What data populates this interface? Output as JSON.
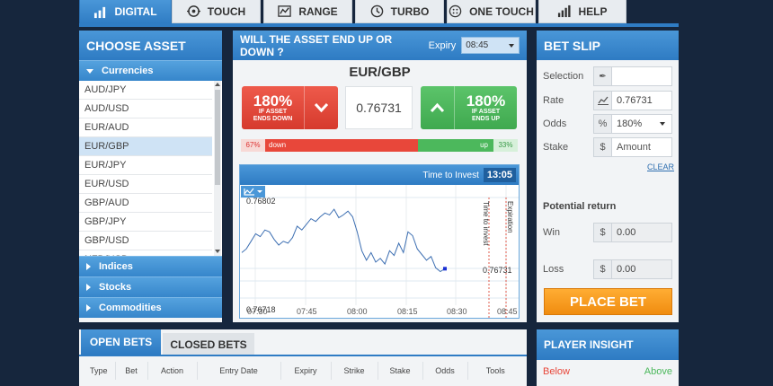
{
  "tabs": [
    {
      "label": "DIGITAL",
      "icon": "bar-chart-icon",
      "active": true
    },
    {
      "label": "TOUCH",
      "icon": "target-icon",
      "active": false
    },
    {
      "label": "RANGE",
      "icon": "range-chart-icon",
      "active": false
    },
    {
      "label": "TURBO",
      "icon": "clock-icon",
      "active": false
    },
    {
      "label": "ONE TOUCH",
      "icon": "dice-icon",
      "active": false
    },
    {
      "label": "HELP",
      "icon": "help-chart-icon",
      "active": false
    }
  ],
  "choose_asset": {
    "title": "CHOOSE ASSET",
    "open_category": "Currencies",
    "assets": [
      "AUD/JPY",
      "AUD/USD",
      "EUR/AUD",
      "EUR/GBP",
      "EUR/JPY",
      "EUR/USD",
      "GBP/AUD",
      "GBP/JPY",
      "GBP/USD",
      "NZD/USD"
    ],
    "selected": "EUR/GBP",
    "other_categories": [
      "Indices",
      "Stocks",
      "Commodities"
    ]
  },
  "question": {
    "title": "WILL THE ASSET END UP OR DOWN ?",
    "expiry_label": "Expiry",
    "expiry_value": "08:45"
  },
  "asset": {
    "name": "EUR/GBP",
    "rate": "0.76731",
    "down_payout": "180%",
    "down_label_1": "IF ASSET",
    "down_label_2": "ENDS DOWN",
    "up_payout": "180%",
    "up_label_1": "IF ASSET",
    "up_label_2": "ENDS UP"
  },
  "sentiment": {
    "down_pct_text": "67%",
    "down_label": "down",
    "up_label": "up",
    "up_pct_text": "33%",
    "down_fraction": 0.67
  },
  "chart": {
    "time_to_invest_label": "Time to Invest",
    "time_to_invest_value": "13:05",
    "vline_invest_label": "Time to invest",
    "vline_expiration_label": "Expiration",
    "high_label": "0.76802",
    "low_label": "0.76718",
    "current_label": "0.76731",
    "x_ticks": [
      "07:30",
      "07:45",
      "08:00",
      "08:15",
      "08:30",
      "08:45"
    ]
  },
  "chart_data": {
    "type": "line",
    "x_ticks": [
      "07:30",
      "07:45",
      "08:00",
      "08:15",
      "08:30",
      "08:45"
    ],
    "series": [
      {
        "values": [
          0.76748,
          0.76752,
          0.7676,
          0.76768,
          0.76765,
          0.76772,
          0.7677,
          0.76762,
          0.76756,
          0.7676,
          0.76758,
          0.76764,
          0.76776,
          0.76772,
          0.76778,
          0.76784,
          0.76781,
          0.76786,
          0.7679,
          0.76788,
          0.76794,
          0.76785,
          0.76788,
          0.76792,
          0.76786,
          0.7677,
          0.7675,
          0.7674,
          0.76748,
          0.76738,
          0.76742,
          0.76736,
          0.7675,
          0.76745,
          0.76758,
          0.76748,
          0.7677,
          0.76766,
          0.76752,
          0.76746,
          0.7674,
          0.76744,
          0.76732,
          0.76728,
          0.76731
        ]
      }
    ],
    "markers": [
      "0.76802",
      "0.76718",
      "0.76731"
    ]
  },
  "bet_slip": {
    "title": "BET SLIP",
    "selection_label": "Selection",
    "selection_value": "",
    "rate_label": "Rate",
    "rate_value": "0.76731",
    "odds_label": "Odds",
    "odds_value": "180%",
    "stake_label": "Stake",
    "stake_placeholder": "Amount",
    "clear_label": "CLEAR",
    "potential_return_label": "Potential return",
    "win_label": "Win",
    "win_value": "0.00",
    "loss_label": "Loss",
    "loss_value": "0.00",
    "currency_symbol": "$",
    "place_bet_label": "PLACE BET"
  },
  "bets": {
    "open_tab": "OPEN BETS",
    "closed_tab": "CLOSED BETS",
    "columns": [
      "Type",
      "Bet",
      "Action",
      "Entry Date",
      "Expiry",
      "Strike",
      "Stake",
      "Odds",
      "Tools"
    ]
  },
  "player_insight": {
    "title": "PLAYER INSIGHT",
    "below_label": "Below",
    "above_label": "Above"
  },
  "colors": {
    "accent": "#2f7cc4",
    "down": "#e8473a",
    "up": "#4cb85c",
    "place_bet": "#f39a1c"
  }
}
